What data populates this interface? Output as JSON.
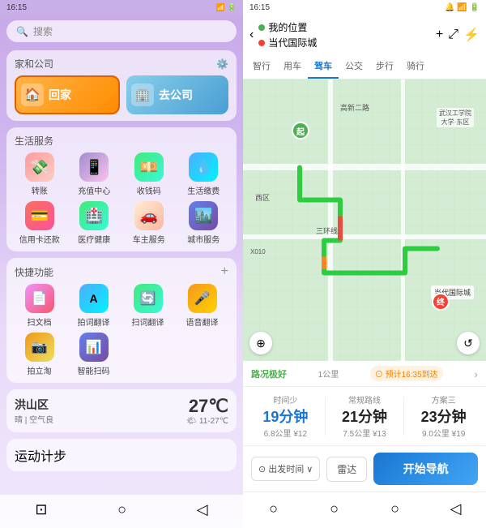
{
  "left": {
    "status_bar": {
      "time": "16:15",
      "signal": "信号",
      "wifi": "WiFi",
      "battery": "电池"
    },
    "search_placeholder": "搜索",
    "sections": {
      "home_work": {
        "title": "家和公司",
        "home_label": "回家",
        "work_label": "去公司"
      },
      "life_services": {
        "title": "生活服务",
        "items": [
          {
            "label": "转账",
            "icon": "💸"
          },
          {
            "label": "充值中心",
            "icon": "📱"
          },
          {
            "label": "收钱码",
            "icon": "💴"
          },
          {
            "label": "生活缴费",
            "icon": "💧"
          },
          {
            "label": "信用卡还款",
            "icon": "💳"
          },
          {
            "label": "医疗健康",
            "icon": "🏥"
          },
          {
            "label": "车主服务",
            "icon": "🚗"
          },
          {
            "label": "城市服务",
            "icon": "🏙️"
          }
        ]
      },
      "quick_functions": {
        "title": "快捷功能",
        "add_label": "+",
        "items": [
          {
            "label": "扫文档",
            "icon": "📄"
          },
          {
            "label": "拍词翻译",
            "icon": "Ａ"
          },
          {
            "label": "扫词翻译",
            "icon": "🔄"
          },
          {
            "label": "语音翻译",
            "icon": "🎤"
          },
          {
            "label": "拍立淘",
            "icon": "📷"
          },
          {
            "label": "智能扫码",
            "icon": "📊"
          }
        ]
      },
      "weather": {
        "city": "洪山区",
        "condition": "晴 | 空气良",
        "temp": "27℃",
        "range_icon": "🌤",
        "range": "11-27℃"
      },
      "steps": {
        "title": "运动计步"
      }
    },
    "bottom_nav": [
      "⊡",
      "○",
      "◁"
    ]
  },
  "right": {
    "status_bar": {
      "time": "16:15",
      "icons": "🔔 📶 🔋"
    },
    "nav_header": {
      "back_icon": "‹",
      "from_label": "我的位置",
      "to_label": "当代国际城",
      "add_icon": "+",
      "route_icon": "⤢",
      "power_icon": "⚡"
    },
    "transport_tabs": [
      {
        "label": "智行"
      },
      {
        "label": "用车"
      },
      {
        "label": "驾车",
        "active": true
      },
      {
        "label": "公交"
      },
      {
        "label": "步行"
      },
      {
        "label": "骑行"
      }
    ],
    "map": {
      "labels": {
        "gaoxi_road": "高新二路",
        "xi_district": "西区",
        "sanhuan": "三环线",
        "destination": "当代国际城",
        "school": "武汉工学院\n大学·东区",
        "x010": "X010"
      },
      "start_label": "起",
      "end_label": "终"
    },
    "route_quality": {
      "label": "路况极好",
      "distance": "1公里",
      "eta_label": "⊙ 预计16:35到达"
    },
    "route_options": [
      {
        "header": "时间少",
        "time": "19分钟",
        "distance": "6.8公里",
        "cost": "¥12"
      },
      {
        "header": "常规路线",
        "time": "21分钟",
        "distance": "7.5公里",
        "cost": "¥13"
      },
      {
        "header": "方案三",
        "time": "23分钟",
        "distance": "9.0公里",
        "cost": "¥19"
      }
    ],
    "bottom_actions": {
      "depart_time_label": "⊙ 出发时间",
      "depart_chevron": "∨",
      "radar_label": "雷达",
      "start_nav_label": "开始导航"
    },
    "bottom_nav": [
      "○",
      "○",
      "○",
      "◁"
    ]
  }
}
